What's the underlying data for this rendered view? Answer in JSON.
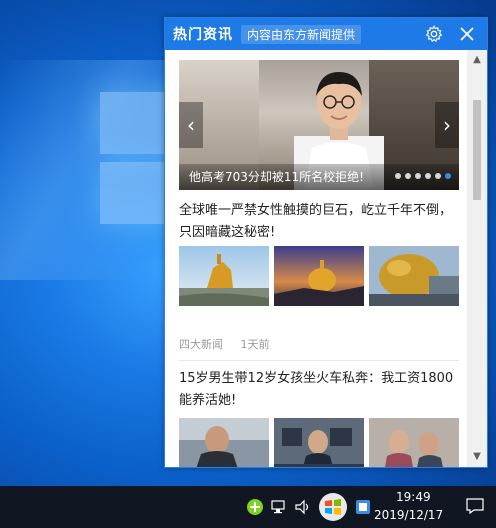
{
  "popup": {
    "title": "热门资讯",
    "subtitle": "内容由东方新闻提供",
    "settings_icon": "gear-icon",
    "close_icon": "close-icon"
  },
  "carousel": {
    "caption": "他高考703分却被11所名校拒绝!",
    "dots": 6,
    "active_dot": 5,
    "prev_icon": "chevron-left-icon",
    "next_icon": "chevron-right-icon"
  },
  "articles": [
    {
      "title": "全球唯一严禁女性触摸的巨石，屹立千年不倒，只因暗藏这秘密!",
      "source": "四大新闻",
      "time": "1天前"
    },
    {
      "title": "15岁男生带12岁女孩坐火车私奔：我工资1800能养活她!",
      "source": "",
      "time": ""
    }
  ],
  "taskbar": {
    "time": "19:49",
    "date": "2019/12/17",
    "tray_icons": [
      "plus-icon",
      "network-icon",
      "volume-icon",
      "windows-badge-icon",
      "app-icon"
    ],
    "notification_icon": "notification-icon"
  },
  "colors": {
    "header": "#1e7ae6",
    "active_dot": "#2f8ef6",
    "taskbar": "#101722"
  }
}
